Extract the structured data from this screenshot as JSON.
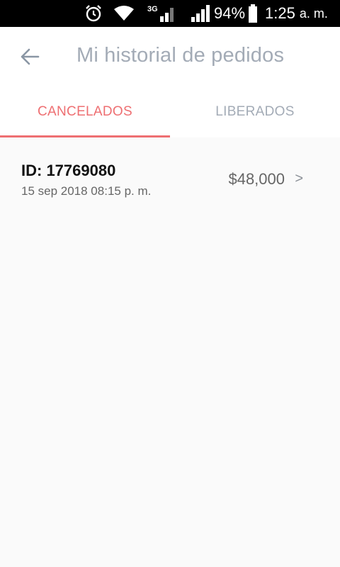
{
  "status_bar": {
    "network_label": "3G",
    "battery": "94%",
    "time": "1:25",
    "ampm": "a. m.",
    "icons": [
      "alarm-icon",
      "wifi-icon",
      "signal-3g-icon",
      "signal-icon",
      "battery-icon"
    ]
  },
  "header": {
    "title": "Mi historial de pedidos",
    "back_icon": "arrow-left-icon"
  },
  "tabs": [
    {
      "label": "CANCELADOS",
      "active": true
    },
    {
      "label": "LIBERADOS",
      "active": false
    }
  ],
  "orders": [
    {
      "id": "ID: 17769080",
      "date": "15 sep 2018 08:15 p. m.",
      "amount": "$48,000",
      "chevron": ">"
    }
  ],
  "colors": {
    "accent": "#ee6f72",
    "muted": "#a3abb6",
    "background": "#fafafa"
  }
}
